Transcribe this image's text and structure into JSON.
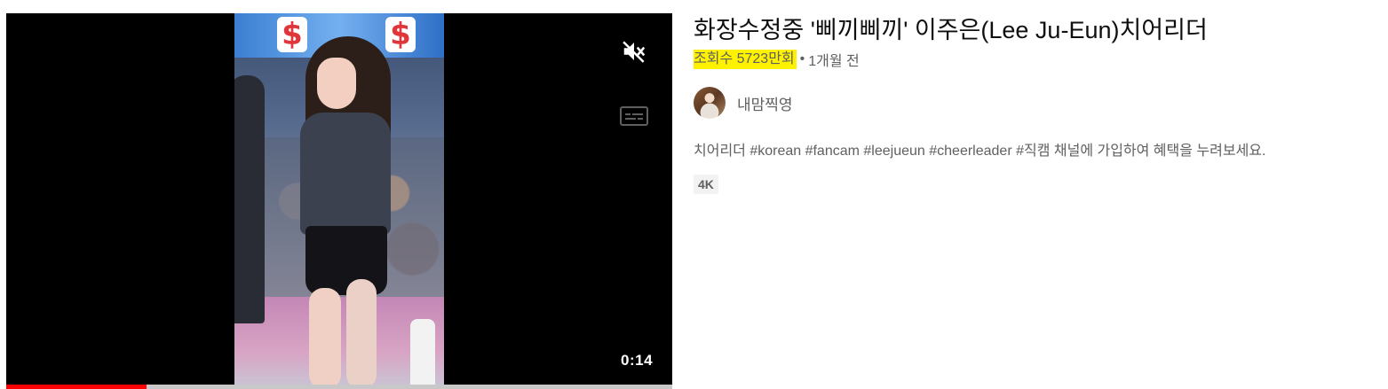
{
  "video": {
    "duration": "0:14",
    "progress_fraction": 0.21,
    "muted_icon": "volume-muted-icon",
    "captions_icon": "closed-captions-icon",
    "thumbnail_banner_glyph": "$",
    "progress_color": "#ff0000"
  },
  "meta": {
    "title": "화장수정중 '삐끼삐끼' 이주은(Lee Ju-Eun)치어리더",
    "views": "조회수 5723만회",
    "separator": "•",
    "age": "1개월 전",
    "views_highlight_color": "#fff200"
  },
  "channel": {
    "name": "내맘찍영",
    "avatar_icon": "channel-avatar"
  },
  "description": "치어리더 #korean #fancam #leejueun #cheerleader #직캠 채널에 가입하여 혜택을 누려보세요.",
  "badge": "4K"
}
